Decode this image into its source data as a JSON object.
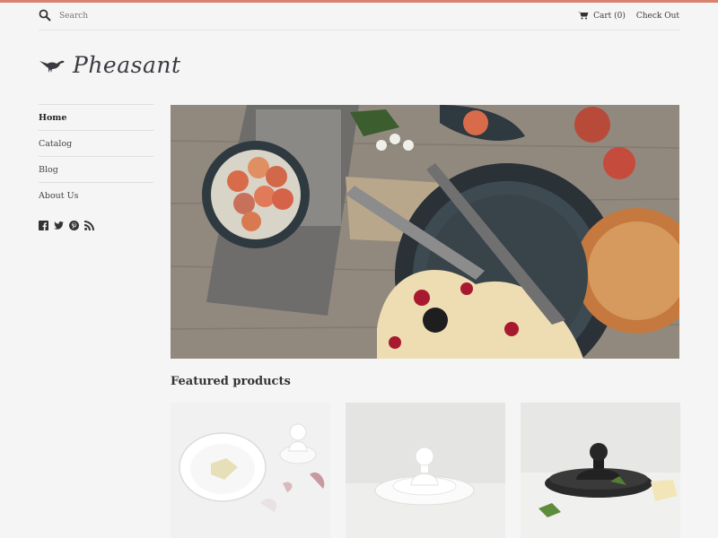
{
  "colors": {
    "accent": "#d98270",
    "background": "#f5f5f5",
    "text": "#3d3d3d"
  },
  "header": {
    "search_placeholder": "Search",
    "cart_label": "Cart (0)",
    "checkout_label": "Check Out"
  },
  "brand": {
    "name": "Pheasant"
  },
  "sidebar": {
    "items": [
      {
        "label": "Home",
        "active": true
      },
      {
        "label": "Catalog",
        "active": false
      },
      {
        "label": "Blog",
        "active": false
      },
      {
        "label": "About Us",
        "active": false
      }
    ],
    "social_icons": [
      "facebook-icon",
      "twitter-icon",
      "pinterest-icon",
      "rss-icon"
    ]
  },
  "main": {
    "featured_title": "Featured products",
    "products": [
      {
        "image": "white-bowl-with-lid-product-image"
      },
      {
        "image": "white-lid-on-saucer-product-image"
      },
      {
        "image": "black-lid-on-dish-product-image"
      }
    ]
  }
}
